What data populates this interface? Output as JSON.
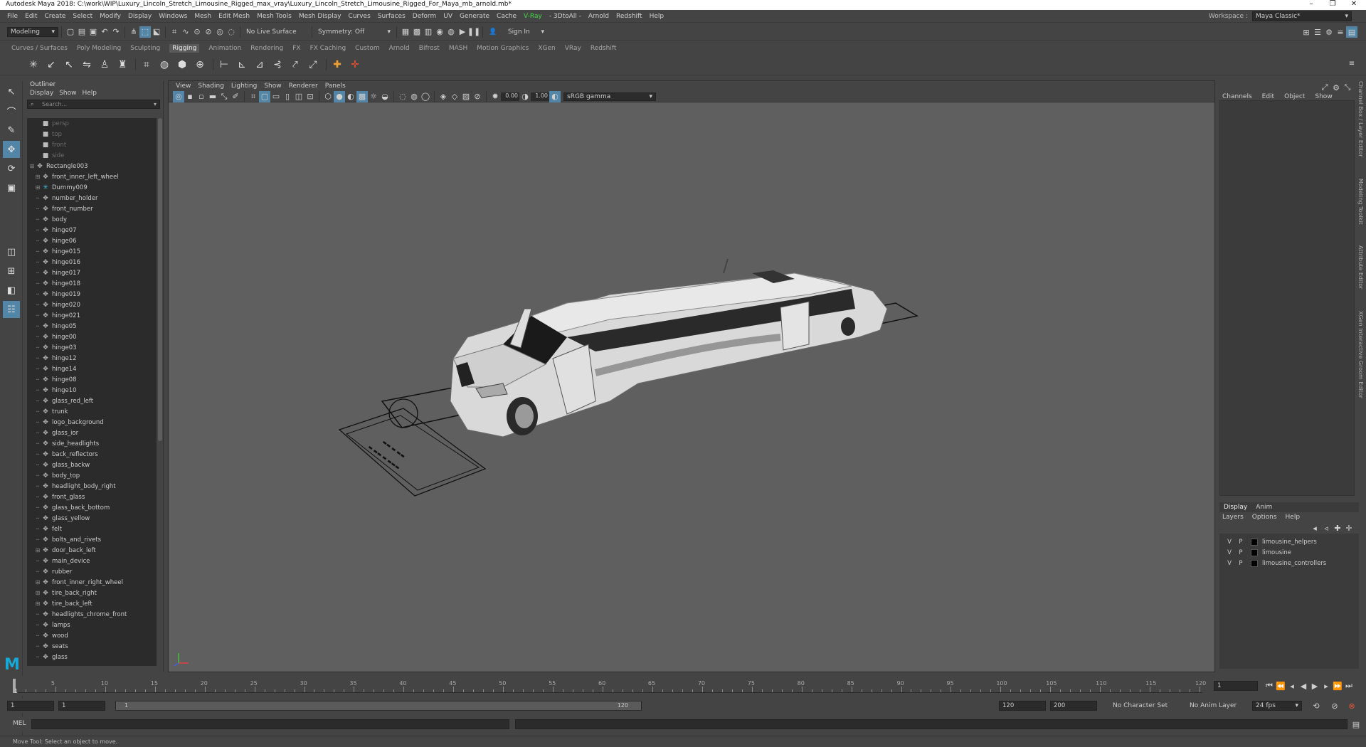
{
  "window": {
    "title": "Autodesk Maya 2018: C:\\work\\WIP\\Luxury_Lincoln_Stretch_Limousine_Rigged_max_vray\\Luxury_Lincoln_Stretch_Limousine_Rigged_For_Maya_mb_arnold.mb*",
    "min": "–",
    "max": "❐",
    "close": "✕"
  },
  "menubar": [
    "File",
    "Edit",
    "Create",
    "Select",
    "Modify",
    "Display",
    "Windows",
    "Mesh",
    "Edit Mesh",
    "Mesh Tools",
    "Mesh Display",
    "Curves",
    "Surfaces",
    "Deform",
    "UV",
    "Generate",
    "Cache",
    "V-Ray",
    "- 3DtoAll -",
    "Arnold",
    "Redshift",
    "Help"
  ],
  "workspace": {
    "label": "Workspace :",
    "value": "Maya Classic*"
  },
  "statusline": {
    "mode": "Modeling",
    "live_surface": "No Live Surface",
    "symmetry": "Symmetry: Off",
    "sign_in": "Sign In"
  },
  "shelf_tabs": [
    "Curves / Surfaces",
    "Poly Modeling",
    "Sculpting",
    "Rigging",
    "Animation",
    "Rendering",
    "FX",
    "FX Caching",
    "Custom",
    "Arnold",
    "Bifrost",
    "MASH",
    "Motion Graphics",
    "XGen",
    "VRay",
    "Redshift"
  ],
  "shelf_active": "Rigging",
  "outliner": {
    "title": "Outliner",
    "menus": [
      "Display",
      "Show",
      "Help"
    ],
    "search_placeholder": "Search...",
    "cameras": [
      "persp",
      "top",
      "front",
      "side"
    ],
    "root": "Rectangle003",
    "items": [
      "front_inner_left_wheel",
      "Dummy009",
      "number_holder",
      "front_number",
      "body",
      "hinge07",
      "hinge06",
      "hinge015",
      "hinge016",
      "hinge017",
      "hinge018",
      "hinge019",
      "hinge020",
      "hinge021",
      "hinge05",
      "hinge00",
      "hinge03",
      "hinge12",
      "hinge14",
      "hinge08",
      "hinge10",
      "glass_red_left",
      "trunk",
      "logo_background",
      "glass_ior",
      "side_headlights",
      "back_reflectors",
      "glass_backw",
      "body_top",
      "headlight_body_right",
      "front_glass",
      "glass_back_bottom",
      "glass_yellow",
      "felt",
      "bolts_and_rivets",
      "door_back_left",
      "main_device",
      "rubber",
      "front_inner_right_wheel",
      "tire_back_right",
      "tire_back_left",
      "headlights_chrome_front",
      "lamps",
      "wood",
      "seats",
      "glass"
    ]
  },
  "viewport": {
    "menus": [
      "View",
      "Shading",
      "Lighting",
      "Show",
      "Renderer",
      "Panels"
    ],
    "exposure": "0.00",
    "gamma": "1.00",
    "colorspace": "sRGB gamma",
    "camera": "persp"
  },
  "channelbox": {
    "menus": [
      "Channels",
      "Edit",
      "Object",
      "Show"
    ]
  },
  "layer_editor": {
    "tabs": [
      "Display",
      "Anim"
    ],
    "menus": [
      "Layers",
      "Options",
      "Help"
    ],
    "layers": [
      {
        "v": "V",
        "p": "P",
        "name": "limousine_helpers"
      },
      {
        "v": "V",
        "p": "P",
        "name": "limousine"
      },
      {
        "v": "V",
        "p": "P",
        "name": "limousine_controllers"
      }
    ]
  },
  "side_tabs": [
    "Channel Box / Layer Editor",
    "Modeling Toolkit",
    "Attribute Editor",
    "XGen Interactive Groom Editor"
  ],
  "timeline": {
    "labels": [
      "5",
      "10",
      "15",
      "20",
      "25",
      "30",
      "35",
      "40",
      "45",
      "50",
      "55",
      "60",
      "65",
      "70",
      "75",
      "80",
      "85",
      "90",
      "95",
      "100",
      "105",
      "110",
      "115",
      "120"
    ],
    "current_frame": "1",
    "current_field": "1"
  },
  "range": {
    "start": "1",
    "start2": "1",
    "slider_start": "1",
    "slider_end": "120",
    "end": "120",
    "end2": "200",
    "character_set": "No Character Set",
    "anim_layer": "No Anim Layer",
    "fps": "24 fps"
  },
  "cmdline": {
    "label": "MEL"
  },
  "helpline": {
    "text": "Move Tool: Select an object to move."
  }
}
